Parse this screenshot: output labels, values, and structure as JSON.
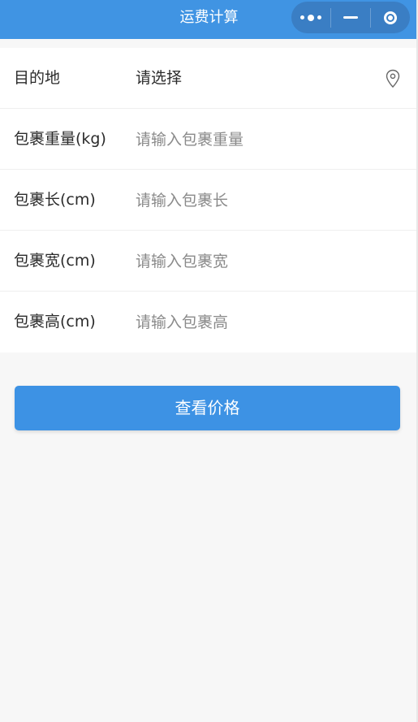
{
  "navbar": {
    "title": "运费计算",
    "background_color": "#4094e3",
    "capsule": {
      "more_icon": "more-dots-icon",
      "minimize_icon": "minimize-icon",
      "close_icon": "target-circle-icon"
    }
  },
  "form": {
    "destination": {
      "label": "目的地",
      "value": "请选择",
      "icon": "location-pin-icon"
    },
    "weight": {
      "label": "包裹重量(kg)",
      "placeholder": "请输入包裹重量",
      "value": ""
    },
    "length": {
      "label": "包裹长(cm)",
      "placeholder": "请输入包裹长",
      "value": ""
    },
    "width": {
      "label": "包裹宽(cm)",
      "placeholder": "请输入包裹宽",
      "value": ""
    },
    "height": {
      "label": "包裹高(cm)",
      "placeholder": "请输入包裹高",
      "value": ""
    }
  },
  "submit": {
    "label": "查看价格",
    "color": "#3d92e4"
  }
}
